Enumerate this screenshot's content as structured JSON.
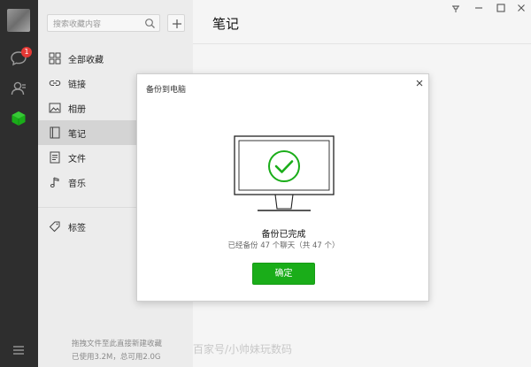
{
  "sidebar": {
    "chat_badge": "1"
  },
  "favorites": {
    "search_placeholder": "搜索收藏内容",
    "items": [
      {
        "label": "全部收藏"
      },
      {
        "label": "链接"
      },
      {
        "label": "相册"
      },
      {
        "label": "笔记"
      },
      {
        "label": "文件"
      },
      {
        "label": "音乐"
      },
      {
        "label": "标签"
      }
    ],
    "footer_hint": "拖拽文件至此直接新建收藏",
    "footer_usage": "已使用3.2M，总可用2.0G"
  },
  "main": {
    "title": "笔记"
  },
  "dialog": {
    "title": "备份到电脑",
    "status": "备份已完成",
    "detail": "已经备份 47 个聊天（共 47 个）",
    "confirm": "确定"
  },
  "watermark": "百家号/小帅妹玩数码",
  "colors": {
    "accent_green": "#1aad19",
    "sidebar_dark": "#2e2e2e",
    "badge_red": "#e53935"
  }
}
